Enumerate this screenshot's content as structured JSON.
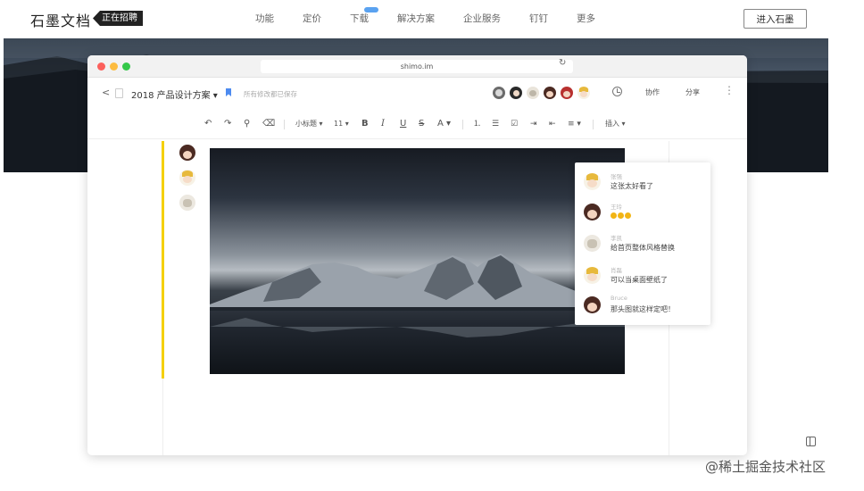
{
  "site": {
    "logo": "石墨文档",
    "hiring_badge": "正在招聘",
    "nav": [
      "功能",
      "定价",
      "下载",
      "解决方案",
      "企业服务",
      "钉钉",
      "更多"
    ],
    "download_badge_color": "#5aa2f0",
    "enter_button": "进入石墨"
  },
  "browser": {
    "url": "shimo.im",
    "traffic_lights": [
      "#fc605c",
      "#fdbc40",
      "#34c84a"
    ]
  },
  "doc": {
    "title": "2018 产品设计方案 ▾",
    "save_status": "所有修改都已保存",
    "collaborator_count": 6,
    "history_icon": "clock-icon",
    "buttons": {
      "collaborate": "协作",
      "share": "分享",
      "more": "⋮"
    }
  },
  "toolbar": {
    "undo": "↶",
    "redo": "↷",
    "format_painter": "⚲",
    "clear_format": "⌫",
    "style": "小标题 ▾",
    "font_size": "11 ▾",
    "bold": "B",
    "italic": "I",
    "underline": "U",
    "strike": "S",
    "font_color": "A ▾",
    "ordered_list": "⒈",
    "bullet_list": "☰",
    "checklist": "☑",
    "indent": "⇥",
    "outdent": "⇤",
    "align": "≡ ▾",
    "insert": "插入 ▾"
  },
  "comments": [
    {
      "name": "张强",
      "text": "这张太好看了",
      "avatar": "blonde-boy"
    },
    {
      "name": "王玲",
      "text": "",
      "emoji_count": 3,
      "avatar": "dark-hair-girl"
    },
    {
      "name": "李凯",
      "text": "给首页整体风格替换",
      "avatar": "cat"
    },
    {
      "name": "肖磊",
      "text": "可以当桌面壁纸了",
      "avatar": "blonde-boy"
    },
    {
      "name": "Bruce",
      "text": "那头图就这样定吧！",
      "avatar": "dark-hair-girl"
    }
  ],
  "watermark": "@稀土掘金技术社区",
  "accent": {
    "comment_bar": "#f5d000"
  }
}
